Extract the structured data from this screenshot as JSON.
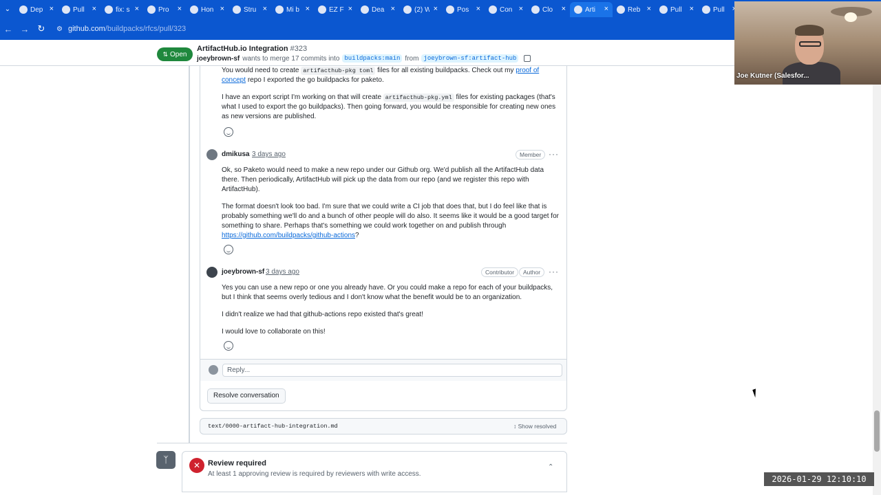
{
  "browser": {
    "tabs": [
      {
        "label": "Dep",
        "icon": "github-icon"
      },
      {
        "label": "Pull",
        "icon": "github-icon"
      },
      {
        "label": "fix: s",
        "icon": "github-icon"
      },
      {
        "label": "Pro",
        "icon": "github-icon"
      },
      {
        "label": "Hon",
        "icon": "globe-icon"
      },
      {
        "label": "Stru",
        "icon": "app-icon"
      },
      {
        "label": "Mi b",
        "icon": "gmail-icon"
      },
      {
        "label": "EZ F",
        "icon": "doc-icon"
      },
      {
        "label": "Dea",
        "icon": "doc-icon"
      },
      {
        "label": "(2) W",
        "icon": "whatsapp-icon"
      },
      {
        "label": "Pos",
        "icon": "app-icon"
      },
      {
        "label": "Con",
        "icon": "app-icon"
      },
      {
        "label": "Clo",
        "icon": "docs-icon"
      },
      {
        "label": "Arti",
        "icon": "github-icon",
        "active": true
      },
      {
        "label": "Reb",
        "icon": "github-icon"
      },
      {
        "label": "Pull",
        "icon": "github-icon"
      },
      {
        "label": "Pull",
        "icon": "github-icon"
      }
    ],
    "url_host": "github.com",
    "url_path": "/buildpacks/rfcs/pull/323"
  },
  "pr": {
    "state": "Open",
    "title": "ArtifactHub.io Integration",
    "number": "#323",
    "author": "joeybrown-sf",
    "merge_text": "wants to merge 17 commits into",
    "base_branch": "buildpacks:main",
    "from_text": "from",
    "head_branch": "joeybrown-sf:artifact-hub"
  },
  "comments": {
    "c0": {
      "p1_a": "You would need to create",
      "p1_code": "artifacthub-pkg toml",
      "p1_b": "files for all existing buildpacks. Check out my",
      "p1_link": "proof of concept",
      "p1_c": "repo I exported the go buildpacks for paketo.",
      "p2_a": "I have an export script I'm working on that will create",
      "p2_code": "artifacthub-pkg.yml",
      "p2_b": "files for existing packages (that's what I used to export the go buildpacks). Then going forward, you would be responsible for creating new ones as new versions are published."
    },
    "c1": {
      "author": "dmikusa",
      "time": "3 days ago",
      "role": "Member",
      "p1": "Ok, so Paketo would need to make a new repo under our Github org. We'd publish all the ArtifactHub data there. Then periodically, ArtifactHub will pick up the data from our repo (and we register this repo with ArtifactHub).",
      "p2": "The format doesn't look too bad. I'm sure that we could write a CI job that does that, but I do feel like that is probably something we'll do and a bunch of other people will do also. It seems like it would be a good target for something to share. Perhaps that's something we could work together on and publish through",
      "p2_link": "https://github.com/buildpacks/github-actions",
      "p2_end": "?"
    },
    "c2": {
      "author": "joeybrown-sf",
      "time": "3 days ago",
      "role1": "Contributor",
      "role2": "Author",
      "p1": "Yes you can use a new repo or one you already have. Or you could make a repo for each of your buildpacks, but I think that seems overly tedious and I don't know what the benefit would be to an organization.",
      "p2": "I didn't realize we had that github-actions repo existed that's great!",
      "p3": "I would love to collaborate on this!"
    }
  },
  "reply_placeholder": "Reply...",
  "resolve_label": "Resolve conversation",
  "file": {
    "name": "text/0000-artifact-hub-integration.md",
    "show_resolved": "Show resolved"
  },
  "review": {
    "title": "Review required",
    "subtitle": "At least 1 approving review is required by reviewers with write access."
  },
  "camera": {
    "name": "Joe Kutner (Salesfor..."
  },
  "timestamp": "2026-01-29 12:10:10",
  "colors": {
    "open_green": "#1f883d",
    "link_blue": "#0969da",
    "error_red": "#cf222e",
    "chrome_blue": "#0b57d0"
  }
}
